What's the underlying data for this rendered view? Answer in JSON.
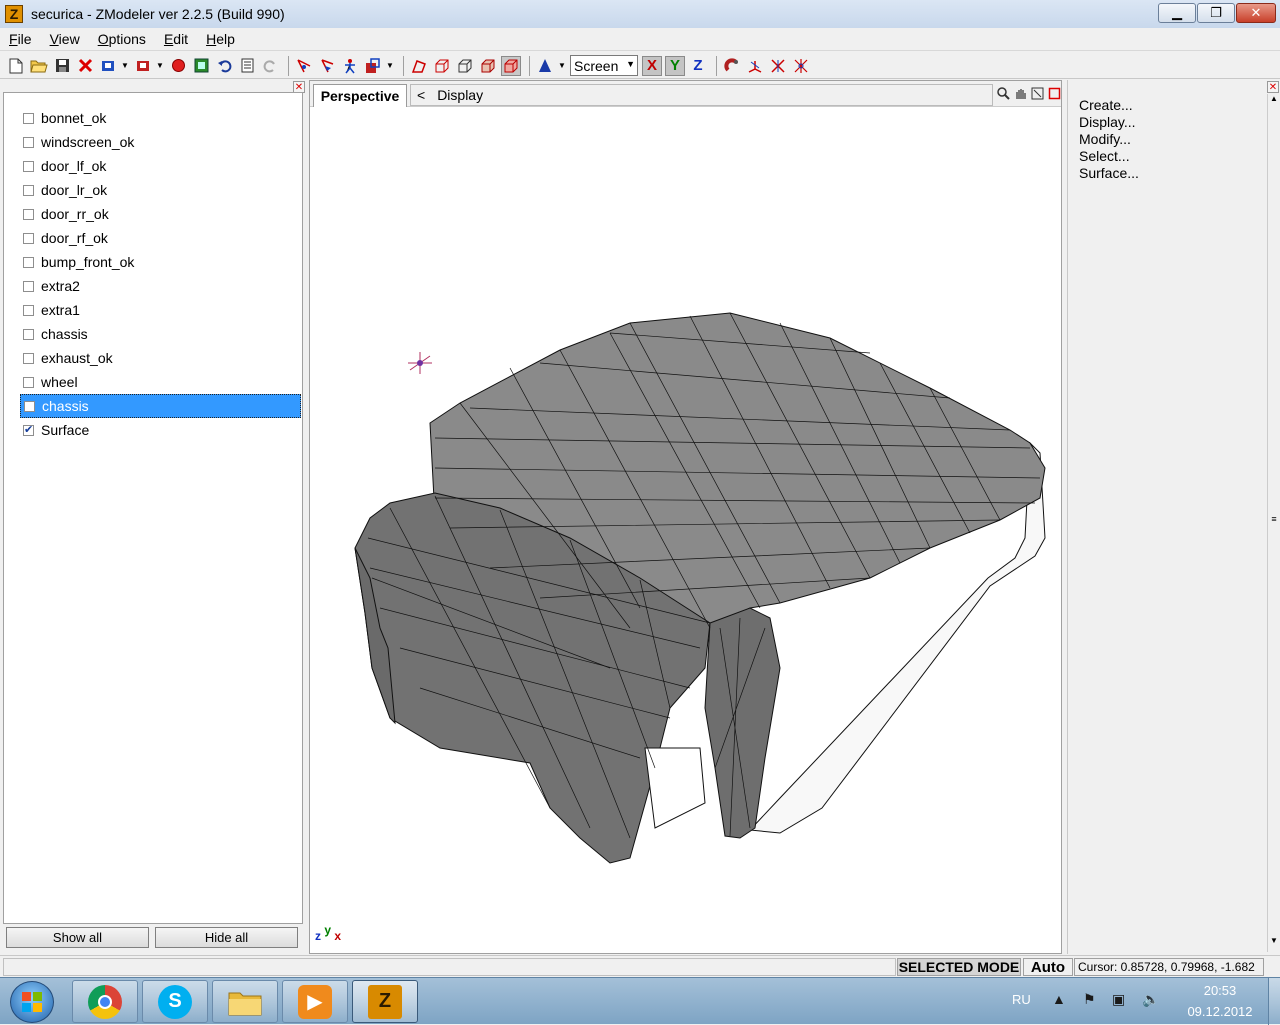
{
  "window": {
    "title": "securica - ZModeler ver 2.2.5 (Build 990)",
    "app_icon_letter": "Z",
    "minimize": "▁",
    "restore": "❐",
    "close": "✕"
  },
  "menu": [
    "File",
    "View",
    "Options",
    "Edit",
    "Help"
  ],
  "toolbar": {
    "view_select": "Screen",
    "axes": [
      "X",
      "Y",
      "Z"
    ],
    "axis_colors": {
      "x": "#c00000",
      "y": "#008000",
      "z": "#1030c0"
    }
  },
  "objects": {
    "items": [
      {
        "label": "bonnet_ok",
        "checked": false
      },
      {
        "label": "windscreen_ok",
        "checked": false
      },
      {
        "label": "door_lf_ok",
        "checked": false
      },
      {
        "label": "door_lr_ok",
        "checked": false
      },
      {
        "label": "door_rr_ok",
        "checked": false
      },
      {
        "label": "door_rf_ok",
        "checked": false
      },
      {
        "label": "bump_front_ok",
        "checked": false
      },
      {
        "label": "extra2",
        "checked": false
      },
      {
        "label": "extra1",
        "checked": false
      },
      {
        "label": "chassis",
        "checked": false
      },
      {
        "label": "exhaust_ok",
        "checked": false
      },
      {
        "label": "wheel",
        "checked": false
      },
      {
        "label": "chassis",
        "checked": false,
        "selected": true
      },
      {
        "label": "Surface",
        "checked": true
      }
    ],
    "show_all": "Show all",
    "hide_all": "Hide all"
  },
  "viewport": {
    "tab": "Perspective",
    "back_arrow": "<",
    "breadcrumb": "Display",
    "axis_labels": {
      "z": "z",
      "y": "y",
      "x": "x"
    },
    "mesh_color": "#7e7e7e"
  },
  "commands": [
    "Create...",
    "Display...",
    "Modify...",
    "Select...",
    "Surface..."
  ],
  "status": {
    "mode": "SELECTED MODE",
    "auto": "Auto",
    "cursor": "Cursor: 0.85728, 0.79968, -1.682"
  },
  "taskbar": {
    "apps": [
      "chrome",
      "skype",
      "explorer",
      "media-player",
      "zmodeler"
    ],
    "lang": "RU",
    "time": "20:53",
    "date": "09.12.2012"
  }
}
